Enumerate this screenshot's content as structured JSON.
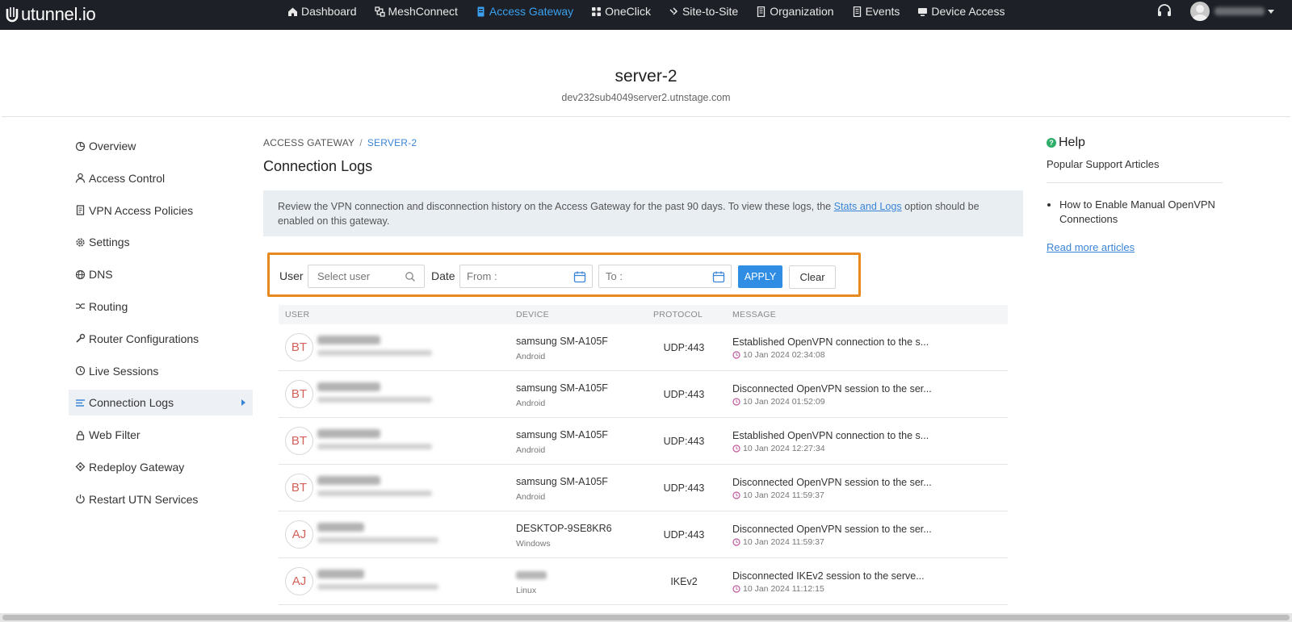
{
  "brand": "utunnel.io",
  "nav": {
    "items": [
      {
        "label": "Dashboard",
        "icon": "home-icon"
      },
      {
        "label": "MeshConnect",
        "icon": "mesh-icon"
      },
      {
        "label": "Access Gateway",
        "icon": "server-icon",
        "active": true
      },
      {
        "label": "OneClick",
        "icon": "grid-icon"
      },
      {
        "label": "Site-to-Site",
        "icon": "link-icon"
      },
      {
        "label": "Organization",
        "icon": "building-icon"
      },
      {
        "label": "Events",
        "icon": "list-icon"
      },
      {
        "label": "Device Access",
        "icon": "monitor-icon"
      }
    ]
  },
  "header": {
    "server_name": "server-2",
    "server_host": "dev232sub4049server2.utnstage.com"
  },
  "sidebar": {
    "items": [
      {
        "label": "Overview",
        "icon": "pie-icon"
      },
      {
        "label": "Access Control",
        "icon": "user-icon"
      },
      {
        "label": "VPN Access Policies",
        "icon": "document-icon"
      },
      {
        "label": "Settings",
        "icon": "gear-icon"
      },
      {
        "label": "DNS",
        "icon": "globe-icon"
      },
      {
        "label": "Routing",
        "icon": "routing-icon"
      },
      {
        "label": "Router Configurations",
        "icon": "wrench-icon"
      },
      {
        "label": "Live Sessions",
        "icon": "clock-icon"
      },
      {
        "label": "Connection Logs",
        "icon": "lines-icon",
        "active": true
      },
      {
        "label": "Web Filter",
        "icon": "lock-icon"
      },
      {
        "label": "Redeploy Gateway",
        "icon": "redeploy-icon"
      },
      {
        "label": "Restart UTN Services",
        "icon": "power-icon"
      }
    ]
  },
  "breadcrumb": {
    "root": "ACCESS GATEWAY",
    "sep": "/",
    "current": "SERVER-2"
  },
  "page_title": "Connection Logs",
  "info": {
    "text_before": "Review the VPN connection and disconnection history on the Access Gateway for the past 90 days. To view these logs, the ",
    "link": "Stats and Logs",
    "text_after": " option should be enabled on this gateway."
  },
  "filters": {
    "user_label": "User",
    "user_placeholder": "Select user",
    "date_label": "Date",
    "from_placeholder": "From :",
    "to_placeholder": "To :",
    "apply": "APPLY",
    "clear": "Clear"
  },
  "table": {
    "columns": [
      "USER",
      "DEVICE",
      "PROTOCOL",
      "MESSAGE"
    ],
    "rows": [
      {
        "initials": "BT",
        "device": "samsung SM-A105F",
        "os": "Android",
        "protocol": "UDP:443",
        "message": "Established OpenVPN connection to the s...",
        "time": "10 Jan 2024 02:34:08"
      },
      {
        "initials": "BT",
        "device": "samsung SM-A105F",
        "os": "Android",
        "protocol": "UDP:443",
        "message": "Disconnected OpenVPN session to the ser...",
        "time": "10 Jan 2024 01:52:09"
      },
      {
        "initials": "BT",
        "device": "samsung SM-A105F",
        "os": "Android",
        "protocol": "UDP:443",
        "message": "Established OpenVPN connection to the s...",
        "time": "10 Jan 2024 12:27:34"
      },
      {
        "initials": "BT",
        "device": "samsung SM-A105F",
        "os": "Android",
        "protocol": "UDP:443",
        "message": "Disconnected OpenVPN session to the ser...",
        "time": "10 Jan 2024 11:59:37"
      },
      {
        "initials": "AJ",
        "device": "DESKTOP-9SE8KR6",
        "os": "Windows",
        "protocol": "UDP:443",
        "message": "Disconnected OpenVPN session to the ser...",
        "time": "10 Jan 2024 11:59:37"
      },
      {
        "initials": "AJ",
        "device": "",
        "os": "Linux",
        "protocol": "IKEv2",
        "message": "Disconnected IKEv2 session to the serve...",
        "time": "10 Jan 2024 11:12:15"
      }
    ]
  },
  "help": {
    "title": "Help",
    "subtitle": "Popular Support Articles",
    "articles": [
      "How to Enable Manual OpenVPN Connections"
    ],
    "more": "Read more articles"
  },
  "colors": {
    "topbar": "#1d2127",
    "accent": "#2f8de4",
    "highlight": "#e8891e",
    "avatar_text": "#d2615a"
  }
}
